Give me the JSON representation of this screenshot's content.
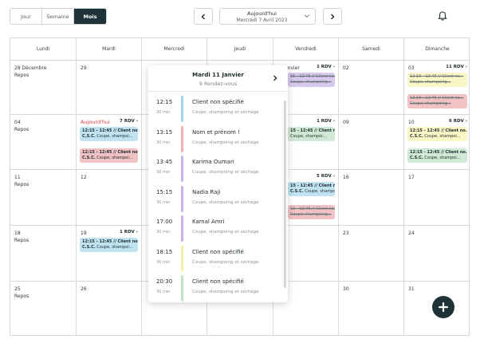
{
  "view_switch": [
    "Jour",
    "Semaine",
    "Mois"
  ],
  "date_nav": {
    "today_label": "Aujourd'hui",
    "current_date": "Mercredi 7 Avril 2023"
  },
  "weekdays": [
    "Lundi",
    "Mardi",
    "Mercredi",
    "Jeudi",
    "Vendredi",
    "Samedi",
    "Dimanche"
  ],
  "cells": {
    "r0": [
      "28 Décembre",
      "29",
      "",
      "",
      "",
      "02",
      "03"
    ],
    "r1": [
      "04",
      "",
      "",
      "",
      "",
      "09",
      "10"
    ],
    "r2": [
      "11",
      "12",
      "",
      "",
      "",
      "16",
      "17"
    ],
    "r3": [
      "18",
      "19",
      "",
      "",
      "",
      "23",
      "24"
    ],
    "r4": [
      "25",
      "26",
      "",
      "",
      "",
      "30",
      "31"
    ]
  },
  "repos": "Repos",
  "today_marker": "Aujourd'hui",
  "rdv_counts": {
    "fri_r0": "1 RDV",
    "sun_r0": "11 RDV",
    "tue_r1": "7 RDV",
    "fri_r1": "1 RDV",
    "sun_r1": "6 RDV",
    "fri_r2": "5 RDV",
    "tue_r3": "1 RDV"
  },
  "fri_r0_partial": "anvier",
  "event_time": "12:15 - 12:45 // Client no...",
  "event_time_short": "15 - 12:45 // Client no...",
  "event_time_short2": "12:15 - 12:45 // Client no...",
  "event_service_code": "C.S.C.",
  "event_service": "Coupe, shampoi...",
  "event_service_long": "Coupe, shampoing...",
  "popup": {
    "title": "Mardi 11 Janvier",
    "subtitle": "9 Rendez-vous",
    "appointments": [
      {
        "time": "12:15",
        "duration": "30 min",
        "name": "Client non spécifié",
        "service": "Coupe, shampoing et séchage",
        "color": "#9fd6ec"
      },
      {
        "time": "13:15",
        "duration": "30 min",
        "name": "Nom et prénom !",
        "service": "Coupe, shampoing et séchage",
        "color": "#f1b1b4"
      },
      {
        "time": "13:45",
        "duration": "30 min",
        "name": "Karima Oumari",
        "service": "Coupe, shampoing et séchage",
        "color": "#c8b4ea"
      },
      {
        "time": "15:15",
        "duration": "30 min",
        "name": "Nadia Raji",
        "service": "Coupe, shampoing et séchage",
        "color": "#c8b4ea"
      },
      {
        "time": "17:00",
        "duration": "30 min",
        "name": "Kamal Amri",
        "service": "Coupe, shampoing et séchage",
        "color": "#c8b4ea"
      },
      {
        "time": "18:15",
        "duration": "30 min",
        "name": "Client non spécifié",
        "service": "Coupe, shampoing et séchage",
        "color": "#f6f0a6"
      },
      {
        "time": "20:30",
        "duration": "30 min",
        "name": "Client non spécifié",
        "service": "Coupe, shampoing et séchage",
        "color": "#bfe3c6"
      }
    ]
  }
}
